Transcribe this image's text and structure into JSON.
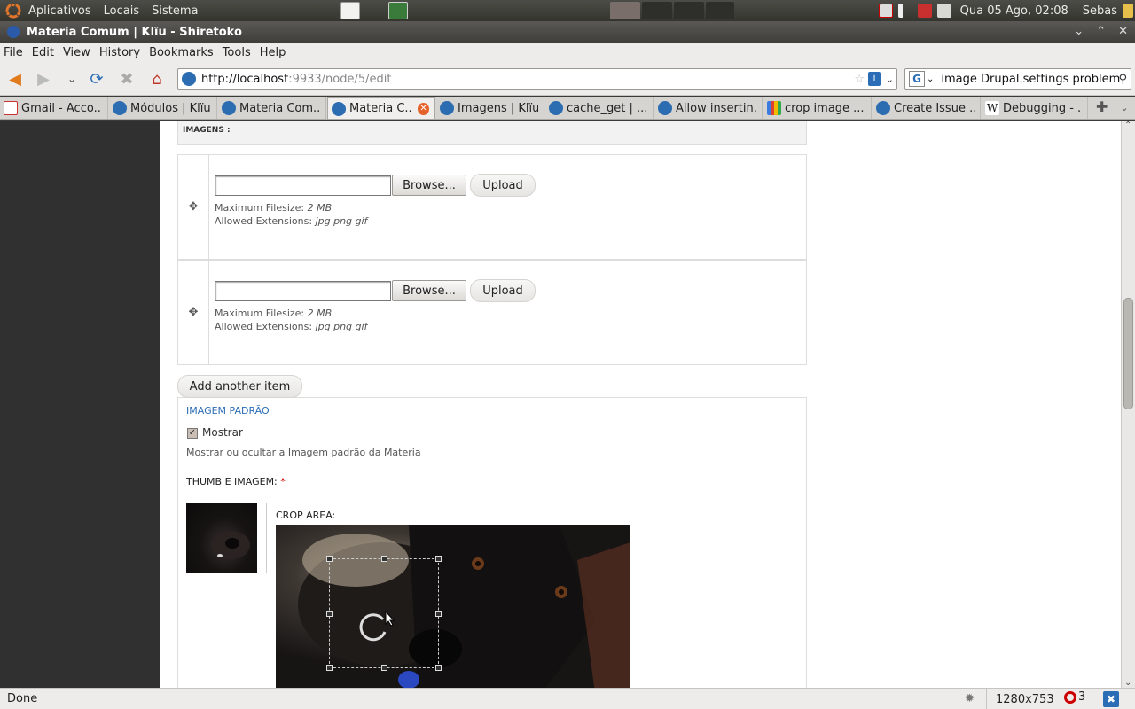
{
  "panel": {
    "menus": [
      "Aplicativos",
      "Locais",
      "Sistema"
    ],
    "clock": "Qua 05 Ago, 02:08",
    "user": "Sebas"
  },
  "window": {
    "title": "Materia Comum | Klïu - Shiretoko"
  },
  "menubar": [
    "File",
    "Edit",
    "View",
    "History",
    "Bookmarks",
    "Tools",
    "Help"
  ],
  "navbar": {
    "url_host": "http://localhost",
    "url_path": ":9933/node/5/edit",
    "search_text": "image Drupal.settings problem"
  },
  "tabs": [
    {
      "label": "Gmail - Acco...",
      "icon": "gmail"
    },
    {
      "label": "Módulos | Klïu",
      "icon": "drupal"
    },
    {
      "label": "Materia Com...",
      "icon": "drupal"
    },
    {
      "label": "Materia C...",
      "icon": "drupal",
      "active": true
    },
    {
      "label": "Imagens | Klïu",
      "icon": "drupal"
    },
    {
      "label": "cache_get | ...",
      "icon": "drupal"
    },
    {
      "label": "Allow insertin...",
      "icon": "drupal"
    },
    {
      "label": "crop image ...",
      "icon": "google"
    },
    {
      "label": "Create Issue ...",
      "icon": "drupal"
    },
    {
      "label": "Debugging - ...",
      "icon": "wiki"
    }
  ],
  "form": {
    "images_header": "IMAGENS :",
    "rows": [
      {
        "browse": "Browse...",
        "upload": "Upload",
        "max_label": "Maximum Filesize:",
        "max_value": "2 MB",
        "ext_label": "Allowed Extensions:",
        "ext_value": "jpg png gif"
      },
      {
        "browse": "Browse...",
        "upload": "Upload",
        "max_label": "Maximum Filesize:",
        "max_value": "2 MB",
        "ext_label": "Allowed Extensions:",
        "ext_value": "jpg png gif"
      }
    ],
    "add_another": "Add another item",
    "legend": "IMAGEM PADRÃO",
    "checkbox_label": "Mostrar",
    "checkbox_checked": true,
    "checkbox_desc": "Mostrar ou ocultar a Imagem padrão da Materia",
    "thumb_label": "THUMB E IMAGEM:",
    "required_mark": "*",
    "crop_label": "CROP AREA:"
  },
  "statusbar": {
    "status": "Done",
    "size": "1280x753",
    "qa_count": "3"
  }
}
